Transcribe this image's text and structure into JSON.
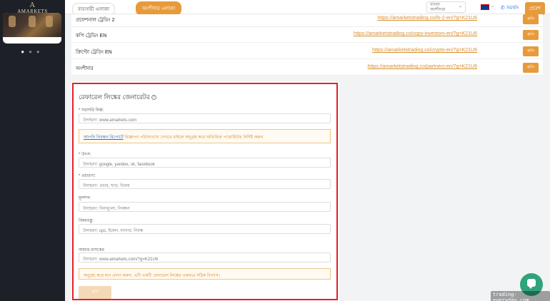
{
  "sidebar": {
    "logo_text": "AMARKETS"
  },
  "topbar": {
    "business_tab": "ব্যবসায়ী এলাকা",
    "partner_tab": "অংশীদার এলাকা",
    "language_label": "বাংলা",
    "language_sub": "অংশীদার",
    "support_label": "সমর্থন",
    "login_label": "প্রবেশ"
  },
  "link_table": {
    "rows": [
      {
        "name": "প্রফেশনাল ট্রেডিং 2",
        "url": "https://amarketstrading.co/fs-2-en/?g=K21U6",
        "copy": "কপি"
      },
      {
        "name": "কপি ট্রেডিং EN",
        "url": "https://amarketstrading.co/copy-investors-en/?g=K21U6",
        "copy": "কপি"
      },
      {
        "name": "ক্রিপ্টো ট্রেডিং EN",
        "url": "https://amarketstrading.co/crypto-en/?g=K21U6",
        "copy": "কপি"
      },
      {
        "name": "অংশীদার",
        "url": "https://amarketstrading.co/partners-en/?g=K21U6",
        "copy": "কপি"
      }
    ]
  },
  "generator": {
    "title": "রেফারেল লিঙ্কের জেনারেটর",
    "direct_link_label": "* সরাসরি লিঙ্ক:",
    "direct_link_placeholder": "উদাহরণ: www.amarkets.com",
    "note1_link": "আপনি নিবন্ধন রিপোর্টে",
    "note1_text": " বিজ্ঞাপন পরিসংখ্যান দেখতে চাইলে অনুগ্রহ করে অতিরিক্ত প্যারামিটার নির্দিষ্ট করুন",
    "source_label": "* উৎস:",
    "source_placeholder": "উদাহরণ: google, yandex, vk, facebook",
    "campaign_label": "* প্রচারণা:",
    "campaign_placeholder": "উদাহরণ: প্রচার, ছাড়, বিক্রয়",
    "keyword_label": "মূলশব্দ:",
    "keyword_placeholder": "উদাহরণ: বিনামূল্যে, নিবন্ধন",
    "content_label": "বিষয়বস্তু:",
    "content_placeholder": "উদাহরণ: cpc, ইমেল, ব্যানার, নিবন্ধ",
    "my_link_label": "আমার রাসকের",
    "my_link_placeholder": "উদাহরণ: www.amarkets.com/?g=K21U6",
    "note2_text": "অনুগ্রহ করে মান প্রদান করুন, এটি একটি রেফারেল লিঙ্কের একমাত্র সঠিক বিন্যাস।",
    "copy_button": "কপি"
  },
  "watermark": "trading-everyday.com"
}
